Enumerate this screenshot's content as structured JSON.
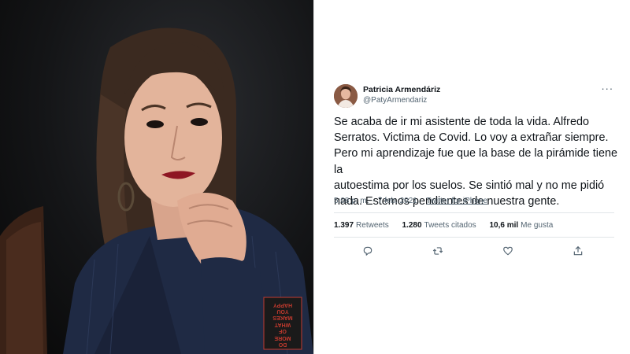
{
  "tweet": {
    "author_name": "Patricia Armendáriz",
    "author_handle": "@PatyArmendariz",
    "more_label": "···",
    "text": "Se acaba de ir mi asistente de toda la vida. Alfredo\nSerratos. Victima de Covid. Lo voy a extrañar siempre.\nPero mi aprendizaje fue que la base de la pirámide tiene la\nautoestima por los suelos. Se sintió mal y no me pidió\nnada. Estemos pendientes de nuestra gente.",
    "time": "5:08 p. m.",
    "separator": "·",
    "date": "7 feb. 2021",
    "source": "Twitter for iPhone",
    "stats": {
      "retweets_count": "1.397",
      "retweets_label": "Retweets",
      "quotes_count": "1.280",
      "quotes_label": "Tweets citados",
      "likes_count": "10,6 mil",
      "likes_label": "Me gusta"
    },
    "actions": [
      "reply-icon",
      "retweet-icon",
      "like-icon",
      "share-icon"
    ]
  },
  "photo": {
    "jacket_text": [
      "DO",
      "MORE",
      "OF",
      "WHAT",
      "MAKES",
      "YOU",
      "HAPPY"
    ]
  },
  "colors": {
    "text_primary": "#0f1419",
    "text_secondary": "#536471",
    "rule": "#e1e5e8",
    "jacket": "#1f2a44",
    "jacket_label": "#c23a2e"
  }
}
